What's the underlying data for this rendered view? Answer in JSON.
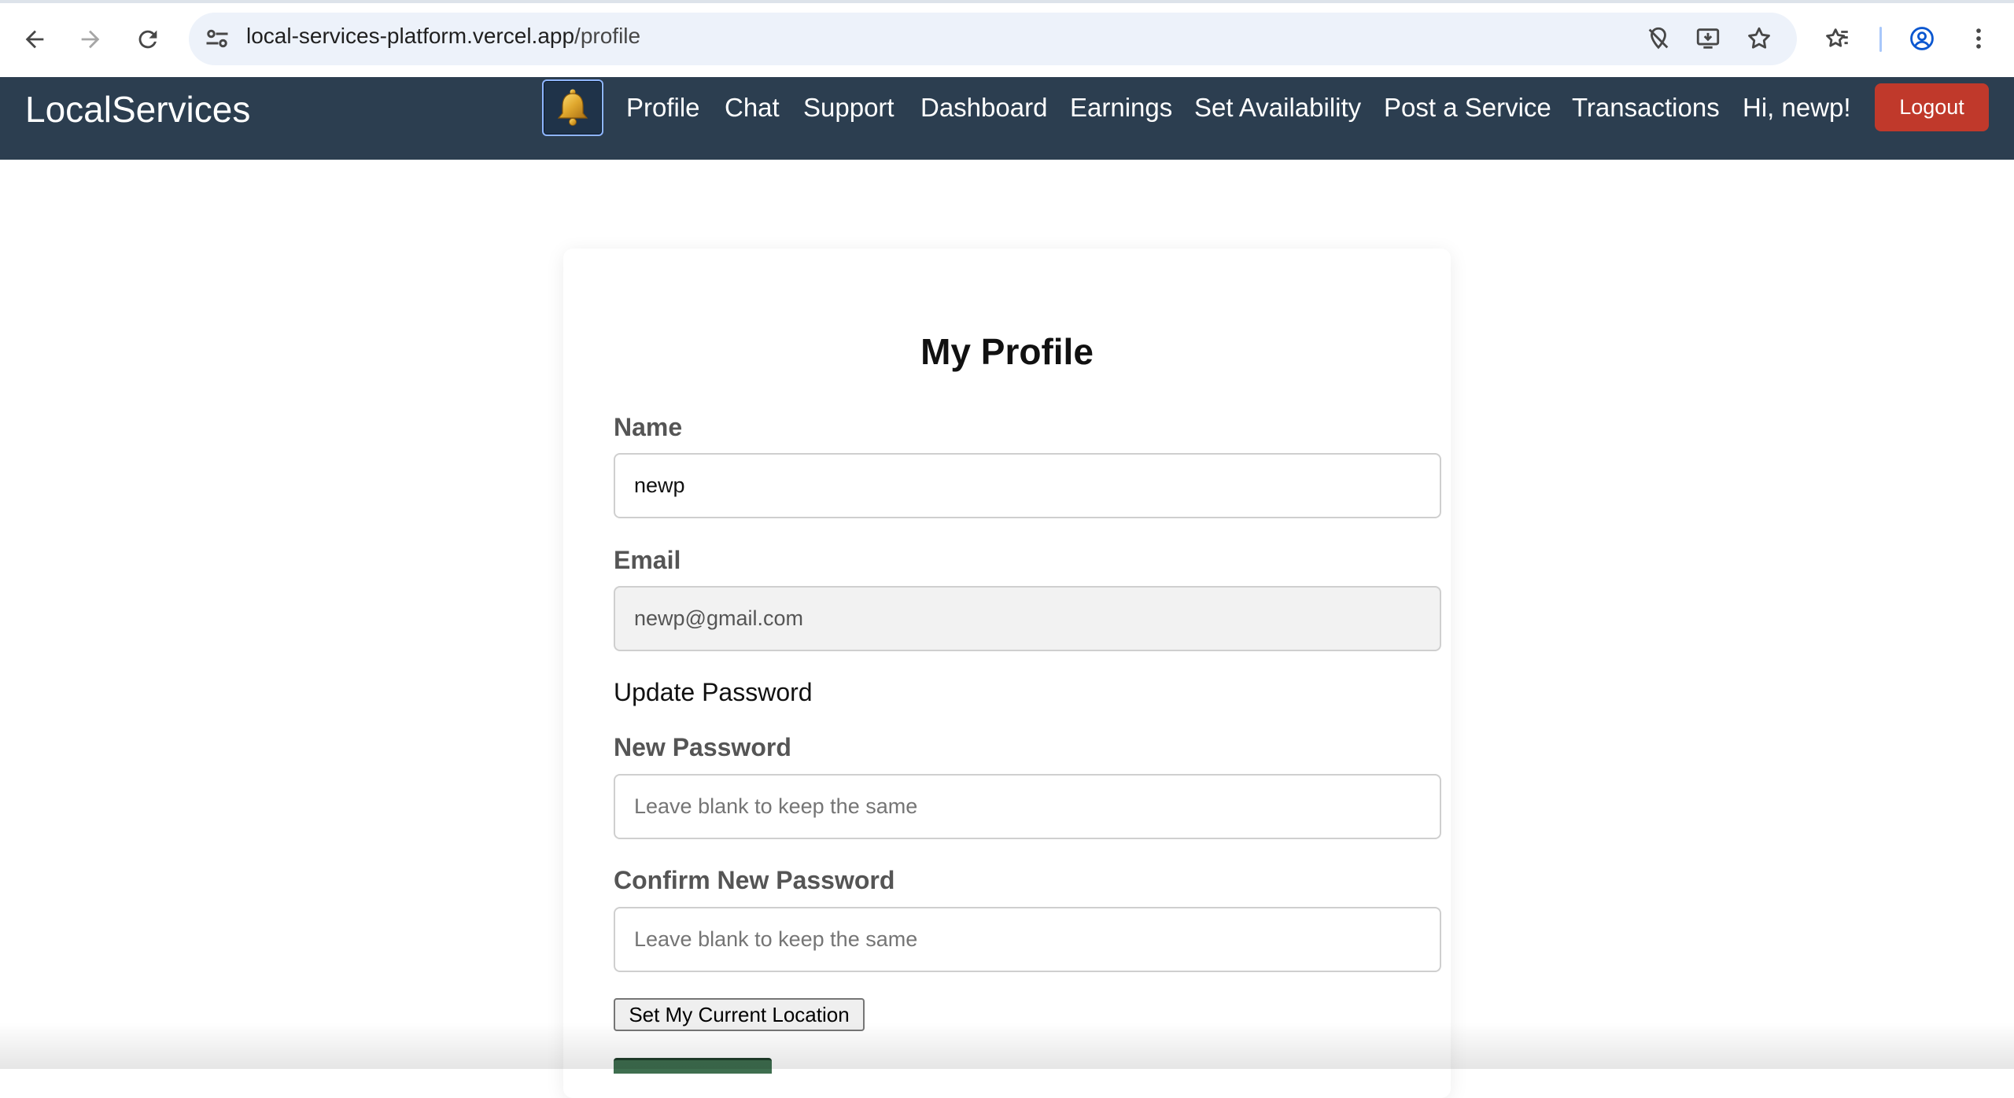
{
  "browser": {
    "url_host": "local-services-platform.vercel.app",
    "url_path": "/profile",
    "icons": [
      "back-arrow-icon",
      "forward-arrow-icon",
      "reload-icon",
      "site-info-icon",
      "tracking-protection-icon",
      "install-app-icon",
      "bookmark-star-icon",
      "bookmarks-icon",
      "profile-icon",
      "kebab-menu-icon"
    ]
  },
  "navbar": {
    "brand": "LocalServices",
    "bell_icon": "bell-icon",
    "links": [
      "Profile",
      "Chat",
      "Support",
      "Dashboard",
      "Earnings",
      "Set Availability",
      "Post a Service",
      "Transactions"
    ],
    "greeting": "Hi, newp!",
    "logout_label": "Logout",
    "colors": {
      "bar": "#2c3e50",
      "logout": "#c0392b"
    }
  },
  "profile": {
    "title": "My Profile",
    "name_label": "Name",
    "name_value": "newp",
    "email_label": "Email",
    "email_value": "newp@gmail.com",
    "update_password_heading": "Update Password",
    "new_password_label": "New Password",
    "new_password_placeholder": "Leave blank to keep the same",
    "confirm_password_label": "Confirm New Password",
    "confirm_password_placeholder": "Leave blank to keep the same",
    "location_button_label": "Set My Current Location"
  }
}
